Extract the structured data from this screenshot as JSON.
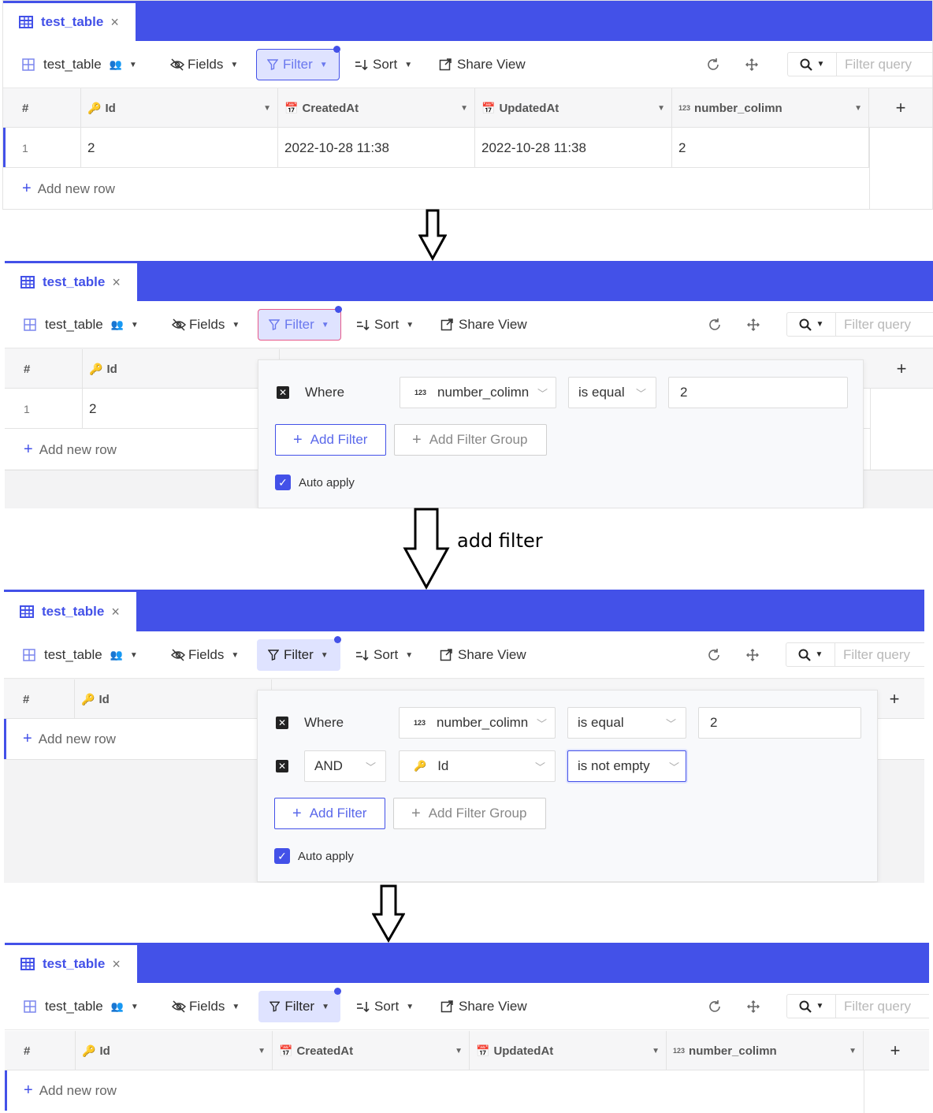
{
  "common": {
    "tab_name": "test_table",
    "tab_close": "×",
    "view_name": "test_table",
    "fields_label": "Fields",
    "filter_label": "Filter",
    "sort_label": "Sort",
    "share_label": "Share View",
    "search_placeholder": "Filter query",
    "add_row_label": "Add new row",
    "add_column": "+",
    "row_num_header": "#",
    "columns": [
      "Id",
      "CreatedAt",
      "UpdatedAt",
      "number_colimn"
    ],
    "accent_color": "#4351e8"
  },
  "panel1": {
    "row": {
      "num": "1",
      "id": "2",
      "created": "2022-10-28 11:38",
      "updated": "2022-10-28 11:38",
      "number": "2"
    }
  },
  "panel2": {
    "row": {
      "num": "1",
      "id": "2"
    },
    "filters": [
      {
        "logic": "Where",
        "field": "number_colimn",
        "op": "is equal",
        "value": "2"
      }
    ],
    "add_filter": "Add Filter",
    "add_filter_group": "Add Filter Group",
    "auto_apply": "Auto apply"
  },
  "annotation": "add filter",
  "panel3": {
    "filters": [
      {
        "logic": "Where",
        "field": "number_colimn",
        "op": "is equal",
        "value": "2"
      },
      {
        "logic": "AND",
        "field": "Id",
        "op": "is not empty",
        "value": ""
      }
    ],
    "add_filter": "Add Filter",
    "add_filter_group": "Add Filter Group",
    "auto_apply": "Auto apply"
  }
}
